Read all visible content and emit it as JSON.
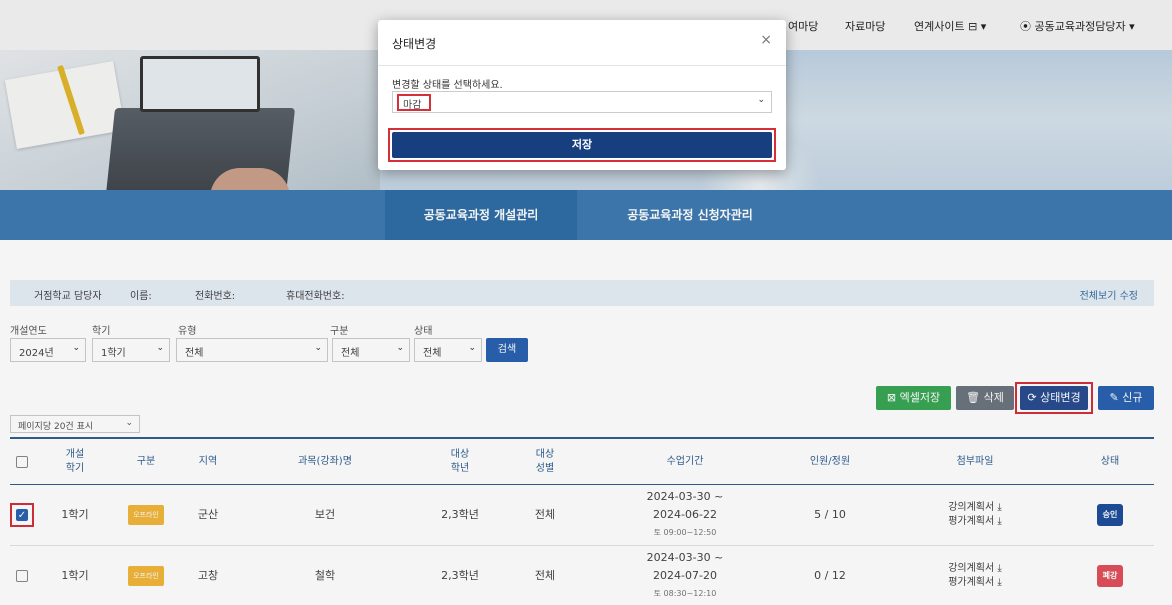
{
  "topnav": {
    "faded_items": [
      "•••",
      "••••••••••",
      "••••••"
    ],
    "items": [
      {
        "name": "nav-item-participate",
        "label": "여마당"
      },
      {
        "name": "nav-item-resources",
        "label": "자료마당"
      },
      {
        "name": "nav-item-linked-sites",
        "label": "연계사이트 ⊟ ▾"
      },
      {
        "name": "nav-item-user",
        "label": "공동교육과정담당자 ▾"
      }
    ]
  },
  "tabs": [
    {
      "label": "공동교육과정 개설관리",
      "active": true
    },
    {
      "label": "공동교육과정 신청자관리",
      "active": false
    }
  ],
  "infobar": {
    "manager": "거점학교 담당자",
    "name": "이름:",
    "phone": "전화번호:",
    "mobile": "휴대전화번호:",
    "edit": "전체보기 수정"
  },
  "filters": {
    "year": {
      "label": "개설연도",
      "value": "2024년"
    },
    "semester": {
      "label": "학기",
      "value": "1학기"
    },
    "type": {
      "label": "유형",
      "value": "전체"
    },
    "category": {
      "label": "구분",
      "value": "전체"
    },
    "status": {
      "label": "상태",
      "value": "전체"
    },
    "search": "검색"
  },
  "actions": {
    "excel": "엑셀저장",
    "delete": "삭제",
    "state": "상태변경",
    "new": "신규"
  },
  "perpage": "페이지당 20건 표시",
  "table": {
    "headers": {
      "semester": "개설\n학기",
      "category": "구분",
      "region": "지역",
      "course": "과목(강좌)명",
      "grade": "대상\n학년",
      "gender": "대상\n성별",
      "period": "수업기간",
      "count": "인원/정원",
      "files": "첨부파일",
      "status": "상태"
    },
    "rows": [
      {
        "checked": true,
        "semester": "1학기",
        "category": "오프라인",
        "region": "군산",
        "course": "보건",
        "grade": "2,3학년",
        "gender": "전체",
        "period_start": "2024-03-30 ~",
        "period_end": "2024-06-22",
        "period_time": "토 09:00~12:50",
        "count": "5 / 10",
        "file1": "강의계획서 ⤓",
        "file2": "평가계획서 ⤓",
        "status": "승인",
        "status_color": "#1f4e9c"
      },
      {
        "checked": false,
        "semester": "1학기",
        "category": "오프라인",
        "region": "고창",
        "course": "철학",
        "grade": "2,3학년",
        "gender": "전체",
        "period_start": "2024-03-30 ~",
        "period_end": "2024-07-20",
        "period_time": "토 08:30~12:10",
        "count": "0 / 12",
        "file1": "강의계획서 ⤓",
        "file2": "평가계획서 ⤓",
        "status": "폐강",
        "status_color": "#e0505a"
      }
    ]
  },
  "modal": {
    "title": "상태변경",
    "close": "×",
    "label": "변경할 상태를 선택하세요.",
    "selected": "마감",
    "save": "저장"
  },
  "colors": {
    "tab_bg": "#3f7ab0",
    "accent": "#173f80",
    "highlight": "#d62f3a"
  }
}
